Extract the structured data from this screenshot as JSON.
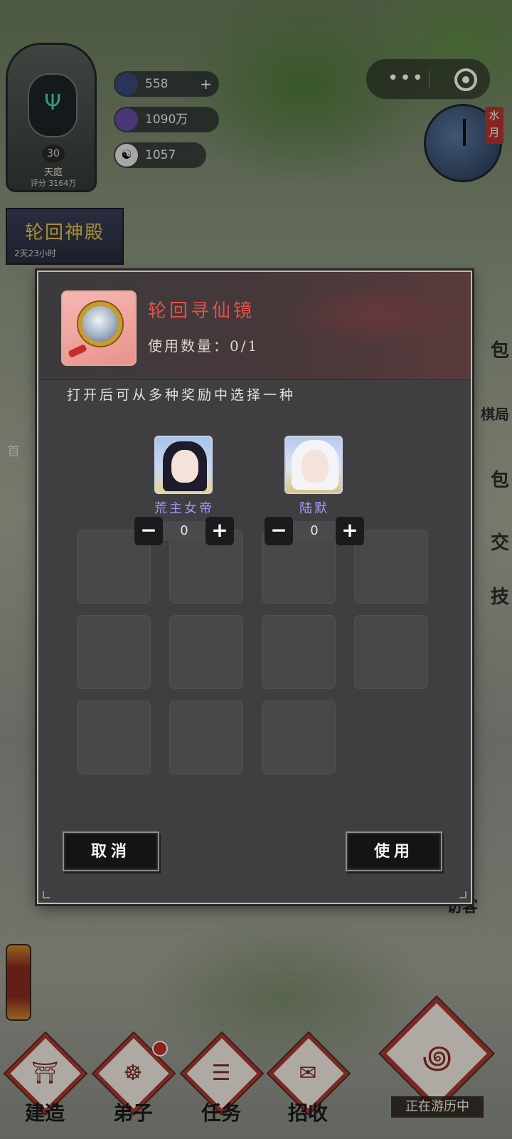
{
  "player": {
    "level": "30",
    "rank": "天庭",
    "score": "评分 3164万"
  },
  "resources": [
    {
      "value": "558",
      "icon": "spirit-stone-icon",
      "has_plus": true
    },
    {
      "value": "1090万",
      "icon": "coin-icon",
      "has_plus": false
    },
    {
      "value": "1057",
      "icon": "yin-yang-icon",
      "has_plus": false
    }
  ],
  "hall": {
    "name": "轮回神殿",
    "timer": "2天23小时"
  },
  "clock": {
    "label": "水月"
  },
  "side_menu": [
    "包",
    "棋局",
    "包",
    "交",
    "技"
  ],
  "left_edge_text": "首",
  "visitor_text": "访客",
  "dialog": {
    "item_name": "轮回寻仙镜",
    "use_count": "使用数量：0/1",
    "description": "打开后可从多种奖励中选择一种",
    "options": [
      {
        "name": "荒主女帝",
        "count": "0",
        "portrait": "female-empress-portrait"
      },
      {
        "name": "陆默",
        "count": "0",
        "portrait": "white-hair-hero-portrait"
      }
    ],
    "cancel_label": "取消",
    "use_label": "使用"
  },
  "bottom_nav": [
    {
      "label": "建造",
      "icon": "building-icon",
      "badge": false
    },
    {
      "label": "弟子",
      "icon": "disciple-icon",
      "badge": true
    },
    {
      "label": "任务",
      "icon": "scroll-icon",
      "badge": false
    },
    {
      "label": "招收",
      "icon": "invitation-icon",
      "badge": false
    }
  ],
  "travel": {
    "label": "正在游历中"
  },
  "colors": {
    "accent_red": "#a63a30",
    "item_name_red": "#e0524a",
    "option_name_purple": "#a29bff"
  }
}
